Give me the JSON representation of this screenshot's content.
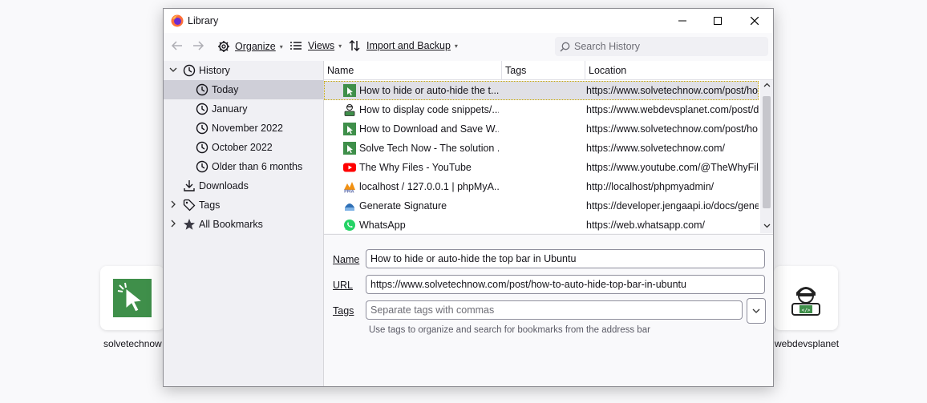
{
  "background_tiles": {
    "left_label": "solvetechnow",
    "right_label": "webdevsplanet"
  },
  "window": {
    "title": "Library",
    "controls": [
      "minimize-icon",
      "maximize-icon",
      "close-icon"
    ]
  },
  "toolbar": {
    "organize_label": "Organize",
    "views_label": "Views",
    "import_label": "Import and Backup",
    "search_placeholder": "Search History"
  },
  "sidebar": {
    "items": [
      {
        "label": "History",
        "icon": "clock-icon",
        "expanded": true
      },
      {
        "label": "Today",
        "icon": "clock-icon",
        "selected": true
      },
      {
        "label": "January",
        "icon": "clock-icon"
      },
      {
        "label": "November 2022",
        "icon": "clock-icon"
      },
      {
        "label": "October 2022",
        "icon": "clock-icon"
      },
      {
        "label": "Older than 6 months",
        "icon": "clock-icon"
      },
      {
        "label": "Downloads",
        "icon": "download-icon"
      },
      {
        "label": "Tags",
        "icon": "tag-icon",
        "expanded": false
      },
      {
        "label": "All Bookmarks",
        "icon": "star-icon",
        "expanded": false
      }
    ]
  },
  "table": {
    "columns": [
      "Name",
      "Tags",
      "Location"
    ],
    "rows": [
      {
        "name": "How to hide or auto-hide the t...",
        "tags": "",
        "location": "https://www.solvetechnow.com/post/ho",
        "favicon": "solvetechnow-icon"
      },
      {
        "name": "How to display code snippets/...",
        "tags": "",
        "location": "https://www.webdevsplanet.com/post/d",
        "favicon": "webdevsplanet-icon"
      },
      {
        "name": "How to Download and Save W...",
        "tags": "",
        "location": "https://www.solvetechnow.com/post/ho",
        "favicon": "solvetechnow-icon"
      },
      {
        "name": "Solve Tech Now - The solution ...",
        "tags": "",
        "location": "https://www.solvetechnow.com/",
        "favicon": "solvetechnow-icon"
      },
      {
        "name": "The Why Files - YouTube",
        "tags": "",
        "location": "https://www.youtube.com/@TheWhyFile",
        "favicon": "youtube-icon"
      },
      {
        "name": "localhost / 127.0.0.1 | phpMyA...",
        "tags": "",
        "location": "http://localhost/phpmyadmin/",
        "favicon": "phpmyadmin-icon"
      },
      {
        "name": "Generate Signature",
        "tags": "",
        "location": "https://developer.jengaapi.io/docs/gener",
        "favicon": "jenga-icon"
      },
      {
        "name": "WhatsApp",
        "tags": "",
        "location": "https://web.whatsapp.com/",
        "favicon": "whatsapp-icon"
      }
    ]
  },
  "details": {
    "name_label": "Name",
    "name_value": "How to hide or auto-hide the top bar in Ubuntu",
    "url_label": "URL",
    "url_value": "https://www.solvetechnow.com/post/how-to-auto-hide-top-bar-in-ubuntu",
    "tags_label": "Tags",
    "tags_placeholder": "Separate tags with commas",
    "tags_hint": "Use tags to organize and search for bookmarks from the address bar"
  },
  "colors": {
    "solvetechnow_green": "#3f8f4a",
    "youtube_red": "#ff0000",
    "whatsapp_green": "#25d366",
    "selection": "#cfcfd8"
  }
}
